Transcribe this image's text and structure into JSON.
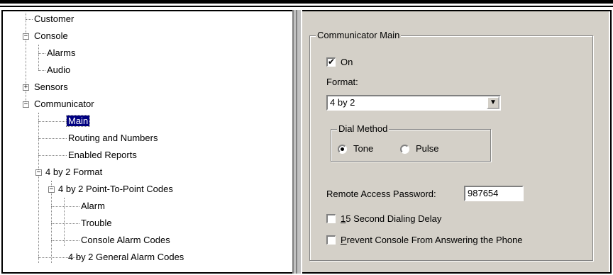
{
  "tree": {
    "items": [
      {
        "label": "Customer",
        "depth": 0
      },
      {
        "label": "Console",
        "depth": 0,
        "expander": "-"
      },
      {
        "label": "Alarms",
        "depth": 1
      },
      {
        "label": "Audio",
        "depth": 1
      },
      {
        "label": "Sensors",
        "depth": 0,
        "expander": "+"
      },
      {
        "label": "Communicator",
        "depth": 0,
        "expander": "-"
      },
      {
        "label": "Main",
        "depth": 1,
        "selected": true
      },
      {
        "label": "Routing and Numbers",
        "depth": 1
      },
      {
        "label": "Enabled Reports",
        "depth": 1
      },
      {
        "label": "4 by 2 Format",
        "depth": 1,
        "expander": "-"
      },
      {
        "label": "4 by 2 Point-To-Point Codes",
        "depth": 2,
        "expander": "-"
      },
      {
        "label": "Alarm",
        "depth": 3
      },
      {
        "label": "Trouble",
        "depth": 3
      },
      {
        "label": "Console Alarm Codes",
        "depth": 3
      },
      {
        "label": "4 by 2 General Alarm Codes",
        "depth": 2
      }
    ]
  },
  "panel": {
    "group_title": "Communicator Main",
    "on_checkbox": {
      "label": "On",
      "checked": true,
      "mark": "✔"
    },
    "format_label": "Format:",
    "format_value": "4 by 2",
    "combo_arrow": "▼",
    "dial_method": {
      "title": "Dial Method",
      "tone_label": "Tone",
      "pulse_label": "Pulse",
      "selected": "Tone"
    },
    "password_label": "Remote Access Password:",
    "password_value": "987654",
    "dialing_delay": {
      "accel": "1",
      "rest": "5 Second Dialing Delay",
      "checked": false
    },
    "prevent_answer": {
      "accel": "P",
      "rest": "revent Console From Answering the Phone",
      "checked": false
    }
  },
  "icons": {
    "expander_minus": "−",
    "expander_plus": "+"
  }
}
